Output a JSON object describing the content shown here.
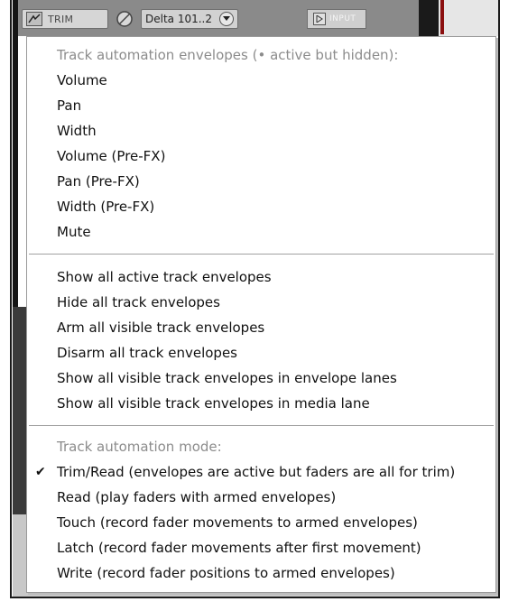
{
  "track_header": {
    "trim_label": "TRIM",
    "track_name": "Delta 101..2",
    "input_label": "INPUT"
  },
  "menu": {
    "envelopes_header": "Track automation envelopes (• active but hidden):",
    "envelopes": [
      "Volume",
      "Pan",
      "Width",
      "Volume (Pre-FX)",
      "Pan (Pre-FX)",
      "Width (Pre-FX)",
      "Mute"
    ],
    "actions": [
      "Show all active track envelopes",
      "Hide all track envelopes",
      "Arm all visible track envelopes",
      "Disarm all track envelopes",
      "Show all visible track envelopes in envelope lanes",
      "Show all visible track envelopes in media lane"
    ],
    "mode_header": "Track automation mode:",
    "modes": [
      "Trim/Read (envelopes are active but faders are all for trim)",
      "Read (play faders with armed envelopes)",
      "Touch (record fader movements to armed envelopes)",
      "Latch (record fader movements after first movement)",
      "Write (record fader positions to armed envelopes)"
    ],
    "checked_mode_index": 0,
    "check_glyph": "✔"
  }
}
